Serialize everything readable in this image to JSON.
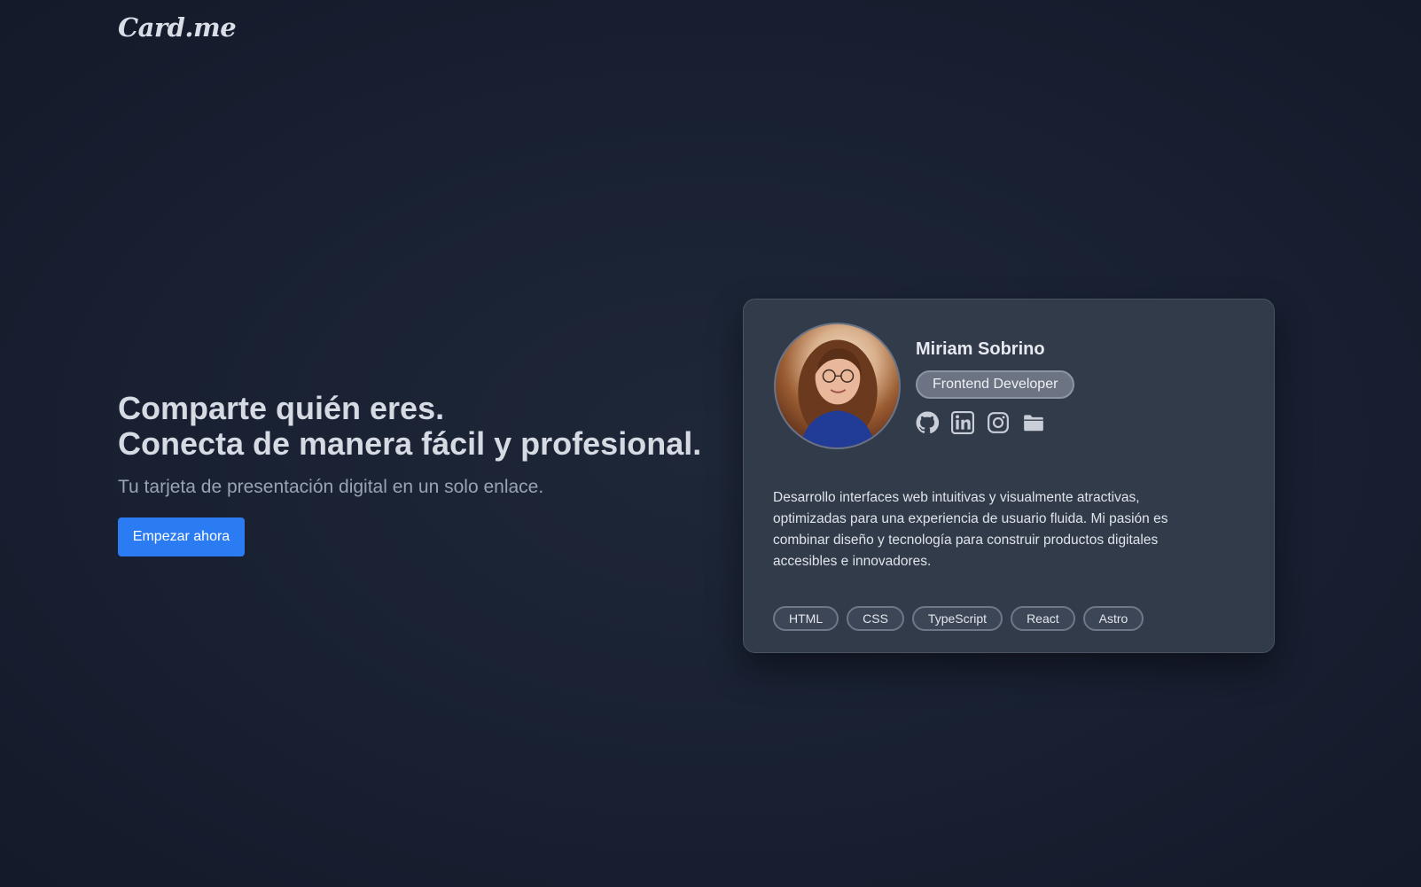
{
  "header": {
    "logo": "Card.me"
  },
  "hero": {
    "title_line1": "Comparte quién eres.",
    "title_line2": "Conecta de manera fácil y profesional.",
    "subtitle": "Tu tarjeta de presentación digital en un solo enlace.",
    "cta_label": "Empezar ahora"
  },
  "card": {
    "name": "Miriam Sobrino",
    "role": "Frontend Developer",
    "social_icons": [
      "github-icon",
      "linkedin-icon",
      "instagram-icon",
      "folder-icon"
    ],
    "bio": "Desarrollo interfaces web intuitivas y visualmente atractivas, optimizadas para una experiencia de usuario fluida. Mi pasión es combinar diseño y tecnología para construir productos digitales accesibles e innovadores.",
    "tags": [
      "HTML",
      "CSS",
      "TypeScript",
      "React",
      "Astro"
    ]
  },
  "colors": {
    "background": "#161e2e",
    "accent": "#2b7cf2",
    "card": "#323b4a"
  }
}
